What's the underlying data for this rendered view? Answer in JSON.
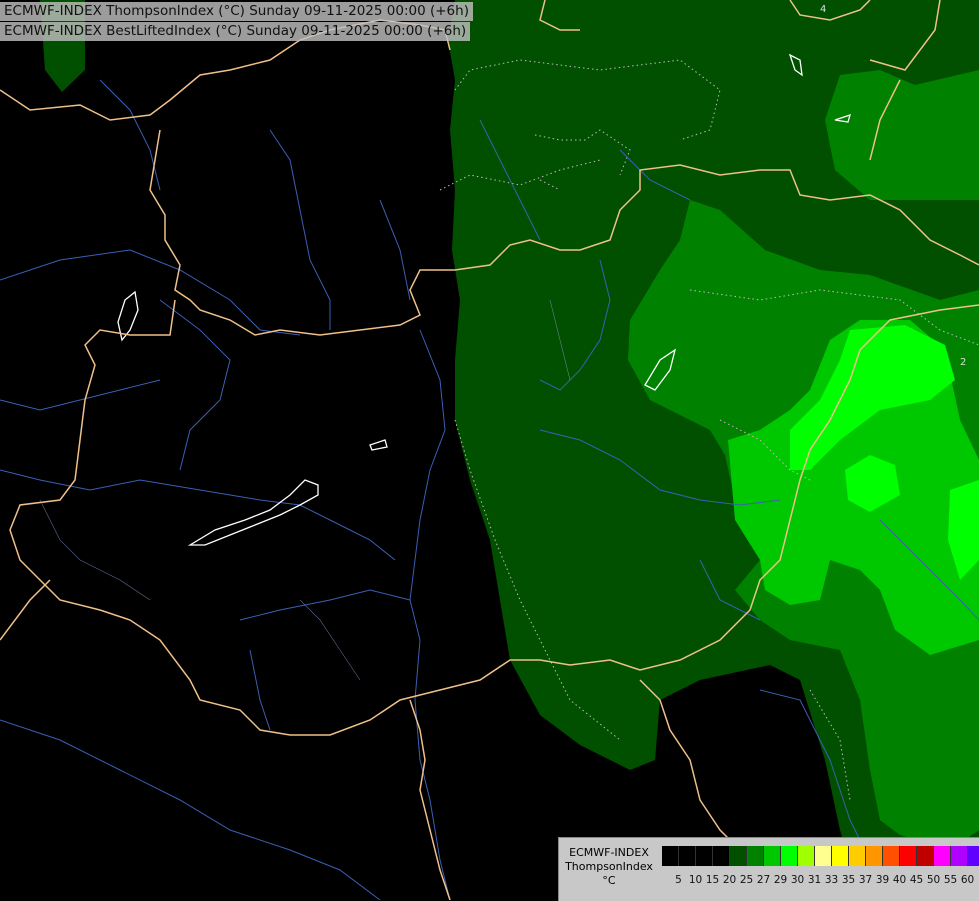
{
  "titles": {
    "line1": "ECMWF-INDEX ThompsonIndex (°C) Sunday 09-11-2025 00:00 (+6h)",
    "line2": "ECMWF-INDEX BestLiftedIndex (°C) Sunday 09-11-2025 00:00 (+6h)"
  },
  "legend": {
    "model": "ECMWF-INDEX",
    "parameter": "ThompsonIndex",
    "unit": "°C",
    "ticks": [
      "5",
      "10",
      "15",
      "20",
      "25",
      "27",
      "29",
      "30",
      "31",
      "33",
      "35",
      "37",
      "39",
      "40",
      "45",
      "50",
      "55",
      "60"
    ],
    "colors": [
      "#000000",
      "#000000",
      "#000000",
      "#000000",
      "#005000",
      "#008200",
      "#00c800",
      "#00ff00",
      "#a0ff00",
      "#ffff90",
      "#ffff00",
      "#ffcc00",
      "#ff9600",
      "#ff5000",
      "#ff0000",
      "#c00000",
      "#ff00ff",
      "#b000ff",
      "#6000ff",
      "#0000ff"
    ]
  },
  "contour_labels": [
    "2",
    "4"
  ]
}
